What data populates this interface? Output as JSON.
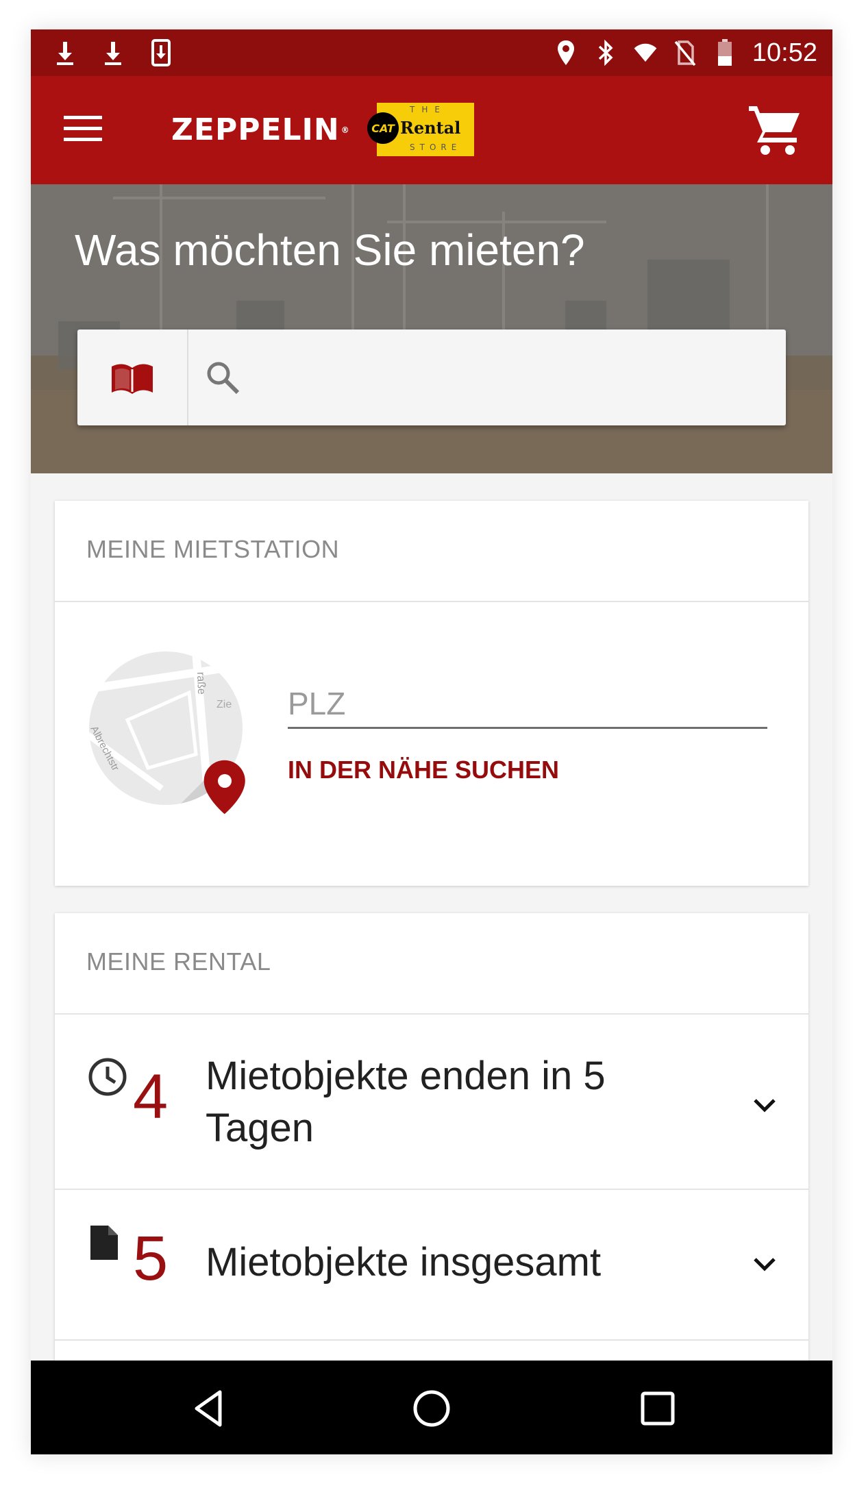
{
  "status_bar": {
    "time": "10:52",
    "left_icons": [
      "download-icon",
      "download-icon",
      "download-box-icon"
    ],
    "right_icons": [
      "location-icon",
      "bluetooth-icon",
      "wifi-icon",
      "no-sim-icon",
      "battery-icon"
    ]
  },
  "app_bar": {
    "brand": "ZEPPELIN",
    "brand_mark": "®",
    "partner_logo": {
      "badge": "CAT",
      "word": "Rental",
      "top": "THE",
      "bottom": "STORE"
    },
    "menu_icon": "menu-icon",
    "cart_icon": "cart-icon",
    "colors": {
      "status_bar": "#8e0e0e",
      "app_bar": "#ac1111",
      "accent": "#9a0f0f"
    }
  },
  "hero": {
    "title": "Was möchten Sie mieten?",
    "search": {
      "placeholder": "",
      "value": ""
    }
  },
  "station_card": {
    "header": "MEINE MIETSTATION",
    "plz_placeholder": "PLZ",
    "nearby_label": "IN DER NÄHE SUCHEN",
    "map_labels": [
      "raße",
      "Zie",
      "Albrechtstr"
    ]
  },
  "rental_card": {
    "header": "MEINE RENTAL",
    "rows": [
      {
        "icon": "clock-icon",
        "count": "4",
        "label": "Mietobjekte enden in 5 Tagen"
      },
      {
        "icon": "document-icon",
        "count": "5",
        "label": "Mietobjekte insgesamt"
      }
    ]
  },
  "nav_bar": {
    "buttons": [
      "back-icon",
      "home-icon",
      "recents-icon"
    ]
  }
}
